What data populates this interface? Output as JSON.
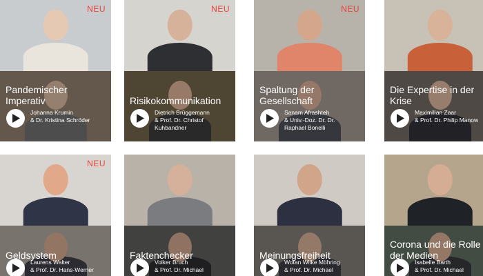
{
  "badge_label": "NEU",
  "cards": [
    {
      "title_lines": [
        "Pandemischer",
        "Imperativ"
      ],
      "names": [
        "Johanna Krumin",
        "& Dr. Kristina Schröder"
      ],
      "badge": true,
      "top_bg": "#c9ccce",
      "top_skin": "#e6c9b3",
      "top_shirt": "#e9e4dc",
      "bottom_bg": "#8a7a69",
      "bottom_skin": "#cfb19a",
      "bottom_shirt": "#6b6b6b"
    },
    {
      "title_lines": [
        "Risikokommunikation"
      ],
      "names": [
        "Dietrich Brüggemann",
        "& Prof. Dr. Christof",
        "Kuhbandner"
      ],
      "badge": true,
      "top_bg": "#d6d4cf",
      "top_skin": "#d7b29b",
      "top_shirt": "#2e2f33",
      "bottom_bg": "#6d6046",
      "bottom_skin": "#d1a990",
      "bottom_shirt": "#3a3a3a"
    },
    {
      "title_lines": [
        "Spaltung der",
        "Gesellschaft"
      ],
      "names": [
        "Sanam Afrashteh",
        "& Univ.-Doz. Dr. Dr.",
        "Raphael Bonelli"
      ],
      "badge": true,
      "top_bg": "#b7b2aa",
      "top_skin": "#d4a78d",
      "top_shirt": "#e0856a",
      "bottom_bg": "#9a9189",
      "bottom_skin": "#cfa78f",
      "bottom_shirt": "#4b4b55"
    },
    {
      "title_lines": [
        "Die Expertise in der",
        "Krise"
      ],
      "names": [
        "Maximilian Zaar",
        "& Prof. Dr. Philip Manow"
      ],
      "badge": false,
      "top_bg": "#c8c1b6",
      "top_skin": "#d9b29a",
      "top_shirt": "#c8613a",
      "bottom_bg": "#6e6660",
      "bottom_skin": "#d2ad96",
      "bottom_shirt": "#2f2f35"
    },
    {
      "title_lines": [
        "Geldsystem"
      ],
      "names": [
        "Laurens Walter",
        "& Prof. Dr. Hans-Werner"
      ],
      "badge": true,
      "top_bg": "#d8d5d0",
      "top_skin": "#e1a88a",
      "top_shirt": "#2f3547",
      "bottom_bg": "#a7a198",
      "bottom_skin": "#cba38a",
      "bottom_shirt": "#3c3c44"
    },
    {
      "title_lines": [
        "Faktenchecker"
      ],
      "names": [
        "Volker Bruch",
        "& Prof. Dr. Michael"
      ],
      "badge": false,
      "top_bg": "#b9b2a9",
      "top_skin": "#d5b09a",
      "top_shirt": "#7b7c80",
      "bottom_bg": "#5b5a58",
      "bottom_skin": "#c79f87",
      "bottom_shirt": "#2b2b2e"
    },
    {
      "title_lines": [
        "Meinungsfreiheit"
      ],
      "names": [
        "Wotan Wilke Möhring",
        "& Prof. Dr. Michael"
      ],
      "badge": false,
      "top_bg": "#cfcbc4",
      "top_skin": "#d1a58a",
      "top_shirt": "#2c3040",
      "bottom_bg": "#7c7670",
      "bottom_skin": "#cfa890",
      "bottom_shirt": "#3a3a40"
    },
    {
      "title_lines": [
        "Corona und die Rolle",
        "der Medien"
      ],
      "names": [
        "Isabelle Barth",
        "& Prof. Dr. Michael"
      ],
      "badge": false,
      "top_bg": "#b6a58d",
      "top_skin": "#d4ad94",
      "top_shirt": "#1f2226",
      "bottom_bg": "#5e6a5c",
      "bottom_skin": "#cda58d",
      "bottom_shirt": "#35363a"
    }
  ]
}
